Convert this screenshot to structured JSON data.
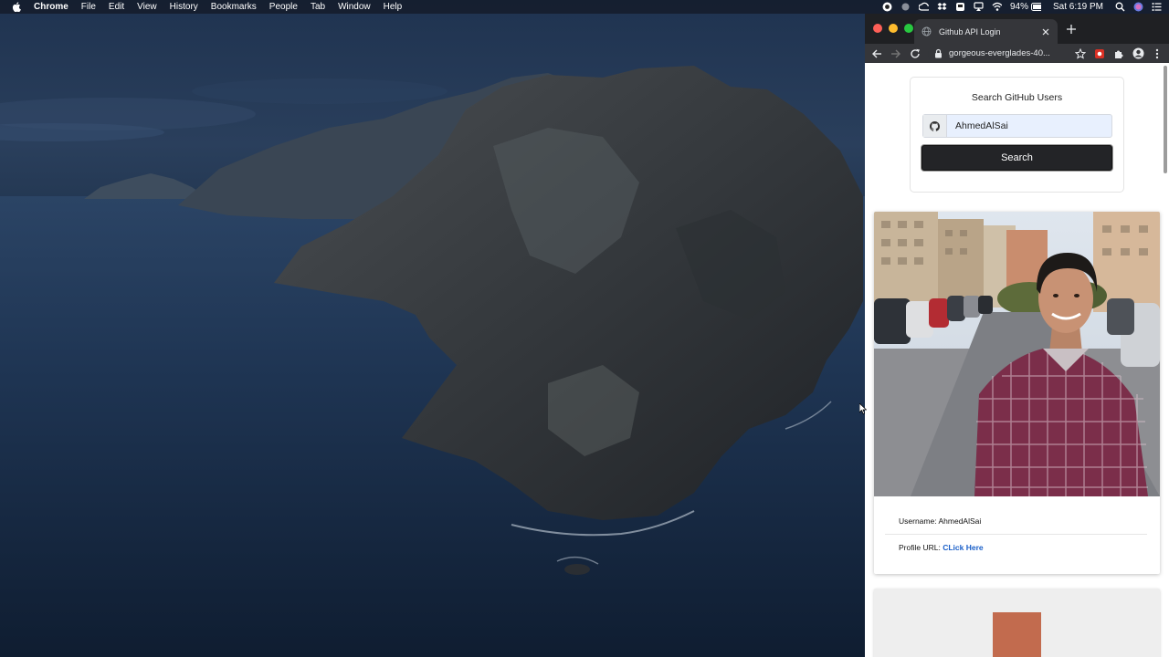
{
  "menubar": {
    "app_name": "Chrome",
    "items": [
      "File",
      "Edit",
      "View",
      "History",
      "Bookmarks",
      "People",
      "Tab",
      "Window",
      "Help"
    ],
    "battery": "94%",
    "clock": "Sat 6:19 PM"
  },
  "browser": {
    "tab_title": "Github API Login",
    "url": "gorgeous-everglades-40..."
  },
  "page": {
    "search_title": "Search GitHub Users",
    "search_value": "AhmedAlSai",
    "search_button": "Search",
    "profile": {
      "username_label": "Username:",
      "username_value": "AhmedAlSai",
      "url_label": "Profile URL:",
      "url_link_text": "CLick Here"
    }
  },
  "colors": {
    "search_button_bg": "#232427",
    "link": "#1a5fc8",
    "input_bg": "#e8f0fe",
    "second_avatar": "#c26b4e"
  }
}
